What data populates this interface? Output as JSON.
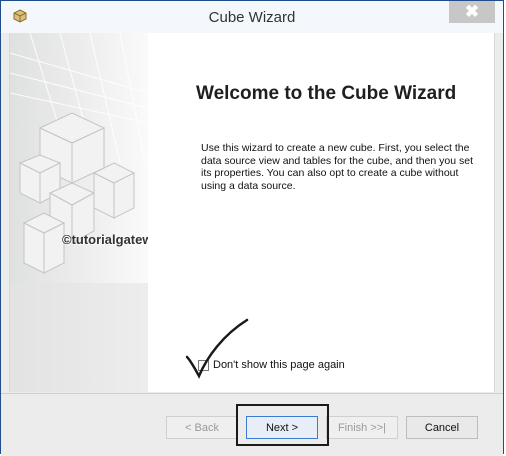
{
  "window": {
    "title": "Cube Wizard",
    "close_glyph": "✖",
    "app_icon": "cube-icon"
  },
  "main": {
    "heading": "Welcome to the Cube Wizard",
    "description": "Use this wizard to create a new cube. First, you select the data source view and tables for the cube, and then you set its properties. You can also opt to create a cube without using a data source.",
    "watermark": "©tutorialgateway.org"
  },
  "options": {
    "dont_show_label": "Don't show this page again",
    "dont_show_checked": false
  },
  "footer": {
    "back_label": "< Back",
    "next_label": "Next >",
    "finish_label": "Finish >>|",
    "cancel_label": "Cancel"
  },
  "colors": {
    "window_border": "#1f4e8c",
    "annotation_stroke": "#1a1a1a",
    "primary_button_border": "#3a7bd5"
  }
}
